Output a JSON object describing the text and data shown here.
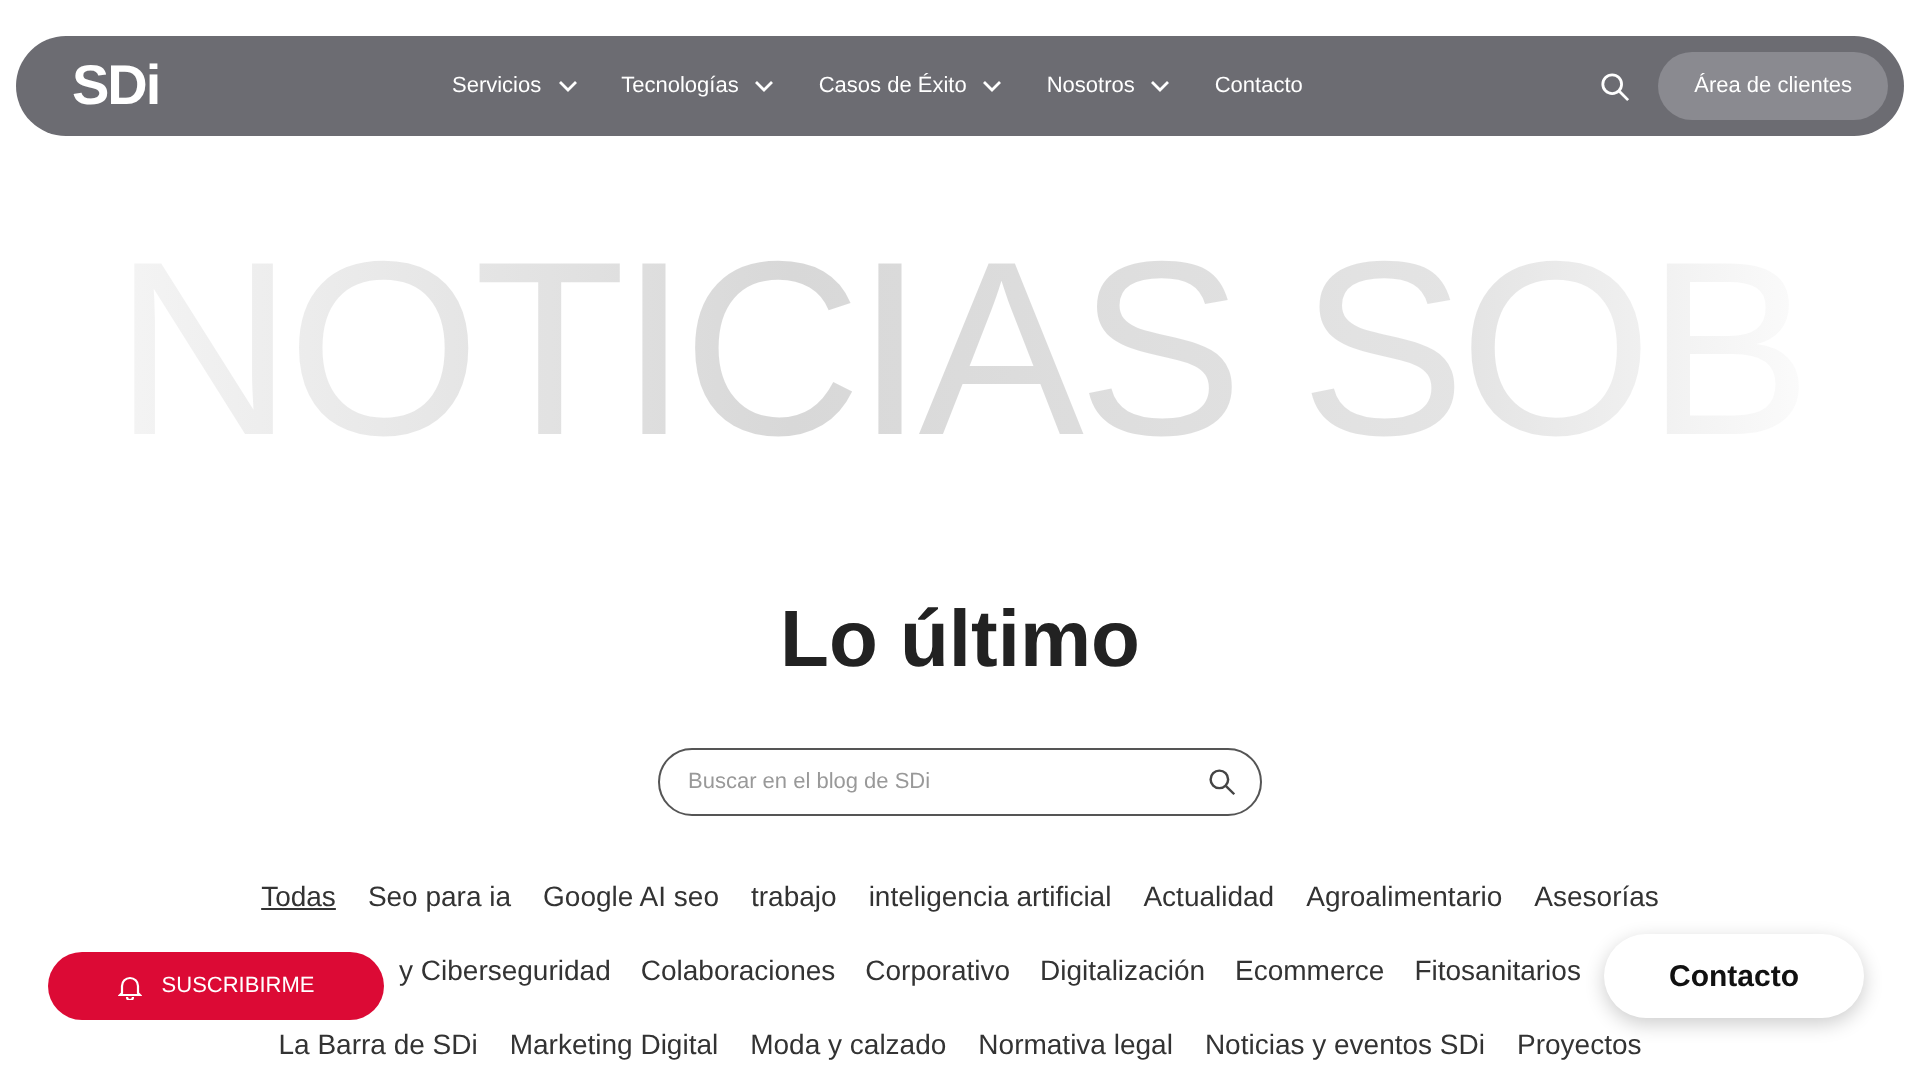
{
  "nav": {
    "logo": "SDi",
    "items": [
      {
        "label": "Servicios",
        "dropdown": true
      },
      {
        "label": "Tecnologías",
        "dropdown": true
      },
      {
        "label": "Casos de Éxito",
        "dropdown": true
      },
      {
        "label": "Nosotros",
        "dropdown": true
      },
      {
        "label": "Contacto",
        "dropdown": false
      }
    ],
    "client_button": "Área de clientes"
  },
  "banner": "NOTICIAS SOB",
  "heading": "Lo último",
  "search": {
    "placeholder": "Buscar en el blog de SDi"
  },
  "tag_rows": [
    [
      {
        "label": "Todas",
        "selected": true
      },
      {
        "label": "Seo para ia",
        "selected": false
      },
      {
        "label": "Google AI seo",
        "selected": false
      },
      {
        "label": "trabajo",
        "selected": false
      },
      {
        "label": "inteligencia artificial",
        "selected": false
      },
      {
        "label": "Actualidad",
        "selected": false
      },
      {
        "label": "Agroalimentario",
        "selected": false
      },
      {
        "label": "Asesorías",
        "selected": false
      }
    ],
    [
      {
        "label": "y Ciberseguridad",
        "selected": false
      },
      {
        "label": "Colaboraciones",
        "selected": false
      },
      {
        "label": "Corporativo",
        "selected": false
      },
      {
        "label": "Digitalización",
        "selected": false
      },
      {
        "label": "Ecommerce",
        "selected": false
      },
      {
        "label": "Fitosanitarios",
        "selected": false
      }
    ],
    [
      {
        "label": "La Barra de SDi",
        "selected": false
      },
      {
        "label": "Marketing Digital",
        "selected": false
      },
      {
        "label": "Moda y calzado",
        "selected": false
      },
      {
        "label": "Normativa legal",
        "selected": false
      },
      {
        "label": "Noticias y eventos SDi",
        "selected": false
      },
      {
        "label": "Proyectos",
        "selected": false
      }
    ]
  ],
  "subscribe_button": "SUSCRIBIRME",
  "contact_button": "Contacto"
}
